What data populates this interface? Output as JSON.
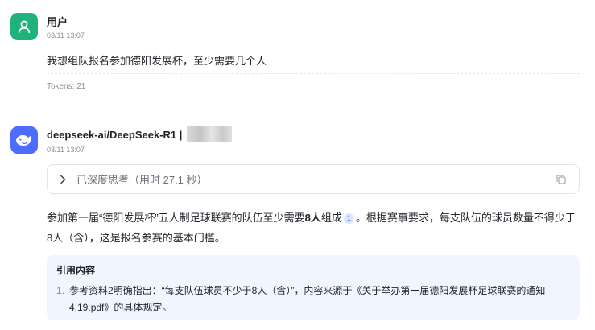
{
  "user": {
    "name": "用户",
    "time": "03/11 13:07",
    "message": "我想组队报名参加德阳发展杯，至少需要几个人",
    "tokens": "Tokens: 21"
  },
  "assistant": {
    "name": "deepseek-ai/DeepSeek-R1 | ",
    "time": "03/11 13:07",
    "thinking_label": "已深度思考（用时 27.1 秒）",
    "answer": {
      "p1": "参加第一届“德阳发展杯”五人制足球联赛的队伍至少需要",
      "bold": "8人",
      "p2": "组成",
      "cite": "1",
      "p3": "。根据赛事要求，每支队伍的球员数量不得少于8人（含），这是报名参赛的基本门槛。"
    },
    "references": {
      "title": "引用内容",
      "items": [
        {
          "num": "1.",
          "text": "参考资料2明确指出：“每支队伍球员不少于8人（含）”，内容来源于《关于举办第一届德阳发展杯足球联赛的通知4.19.pdf》的具体规定。"
        }
      ]
    }
  },
  "colors": {
    "user_avatar": "#1fb27a",
    "bot_avatar": "#4d6bfe",
    "reference_bg": "#f0f5ff"
  },
  "icons": [
    "user-icon",
    "whale-icon",
    "chevron-right-icon",
    "copy-icon"
  ]
}
